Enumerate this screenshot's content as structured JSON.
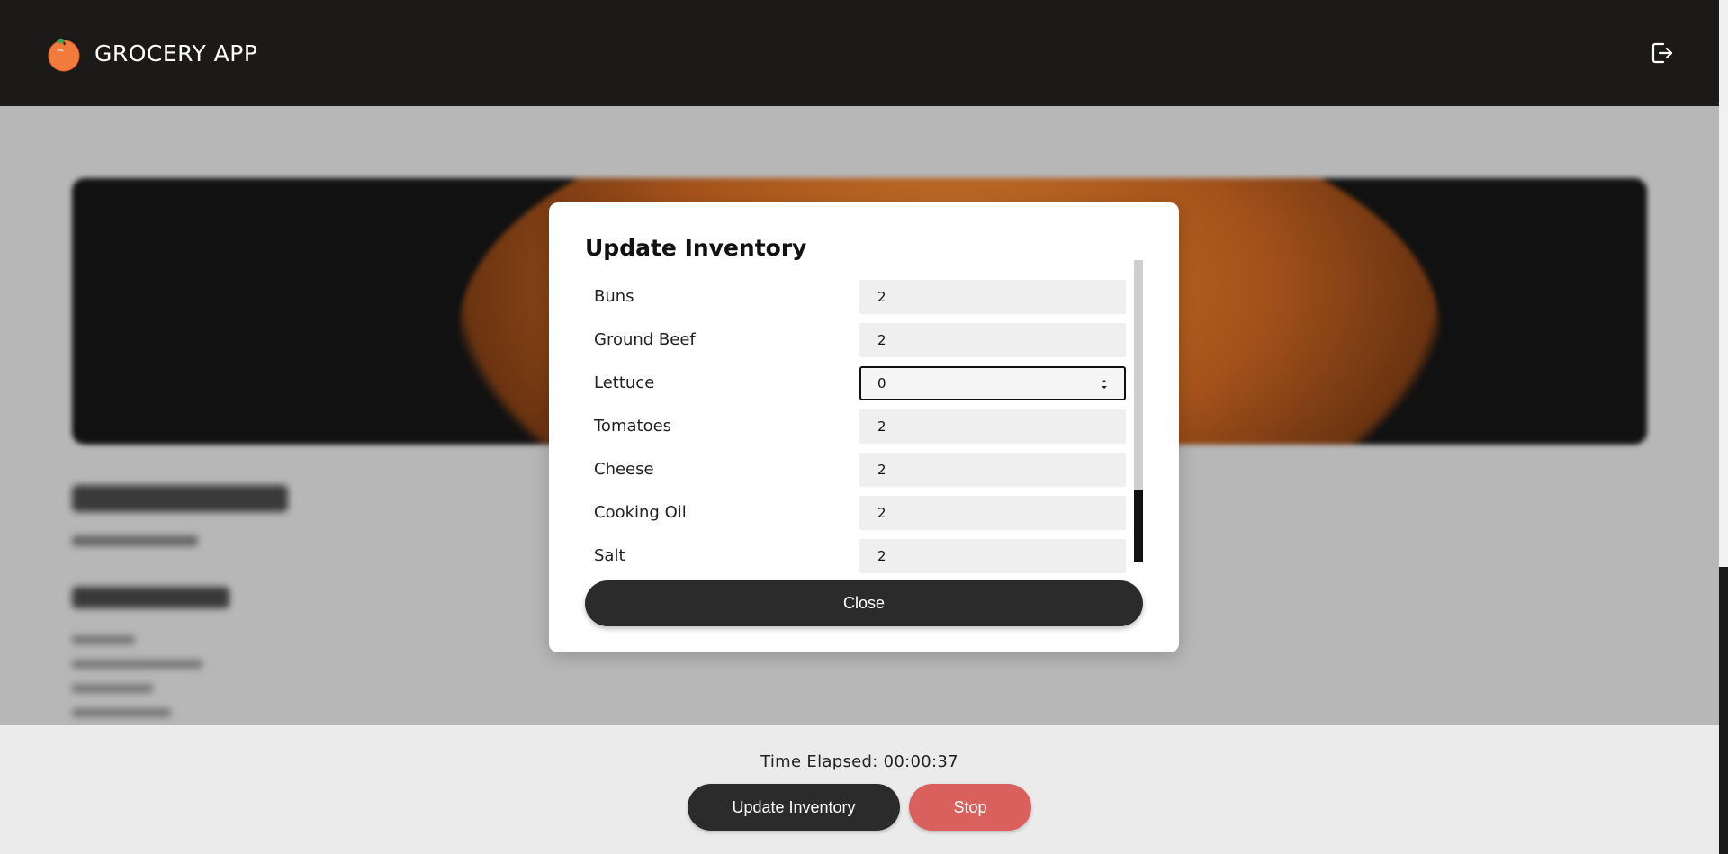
{
  "header": {
    "title": "GROCERY APP",
    "logo_icon": "orange-icon",
    "logout_icon": "logout-icon"
  },
  "modal": {
    "title": "Update Inventory",
    "items": [
      {
        "label": "Buns",
        "value": "2"
      },
      {
        "label": "Ground Beef",
        "value": "2"
      },
      {
        "label": "Lettuce",
        "value": "0"
      },
      {
        "label": "Tomatoes",
        "value": "2"
      },
      {
        "label": "Cheese",
        "value": "2"
      },
      {
        "label": "Cooking Oil",
        "value": "2"
      },
      {
        "label": "Salt",
        "value": "2"
      }
    ],
    "close_label": "Close"
  },
  "footer": {
    "timer": "Time Elapsed: 00:00:37",
    "update_label": "Update Inventory",
    "stop_label": "Stop"
  },
  "colors": {
    "header_bg": "#1c1a19",
    "dark_button": "#2b2b2b",
    "stop_button": "#d9605d",
    "footer_bg": "#ebebeb"
  }
}
